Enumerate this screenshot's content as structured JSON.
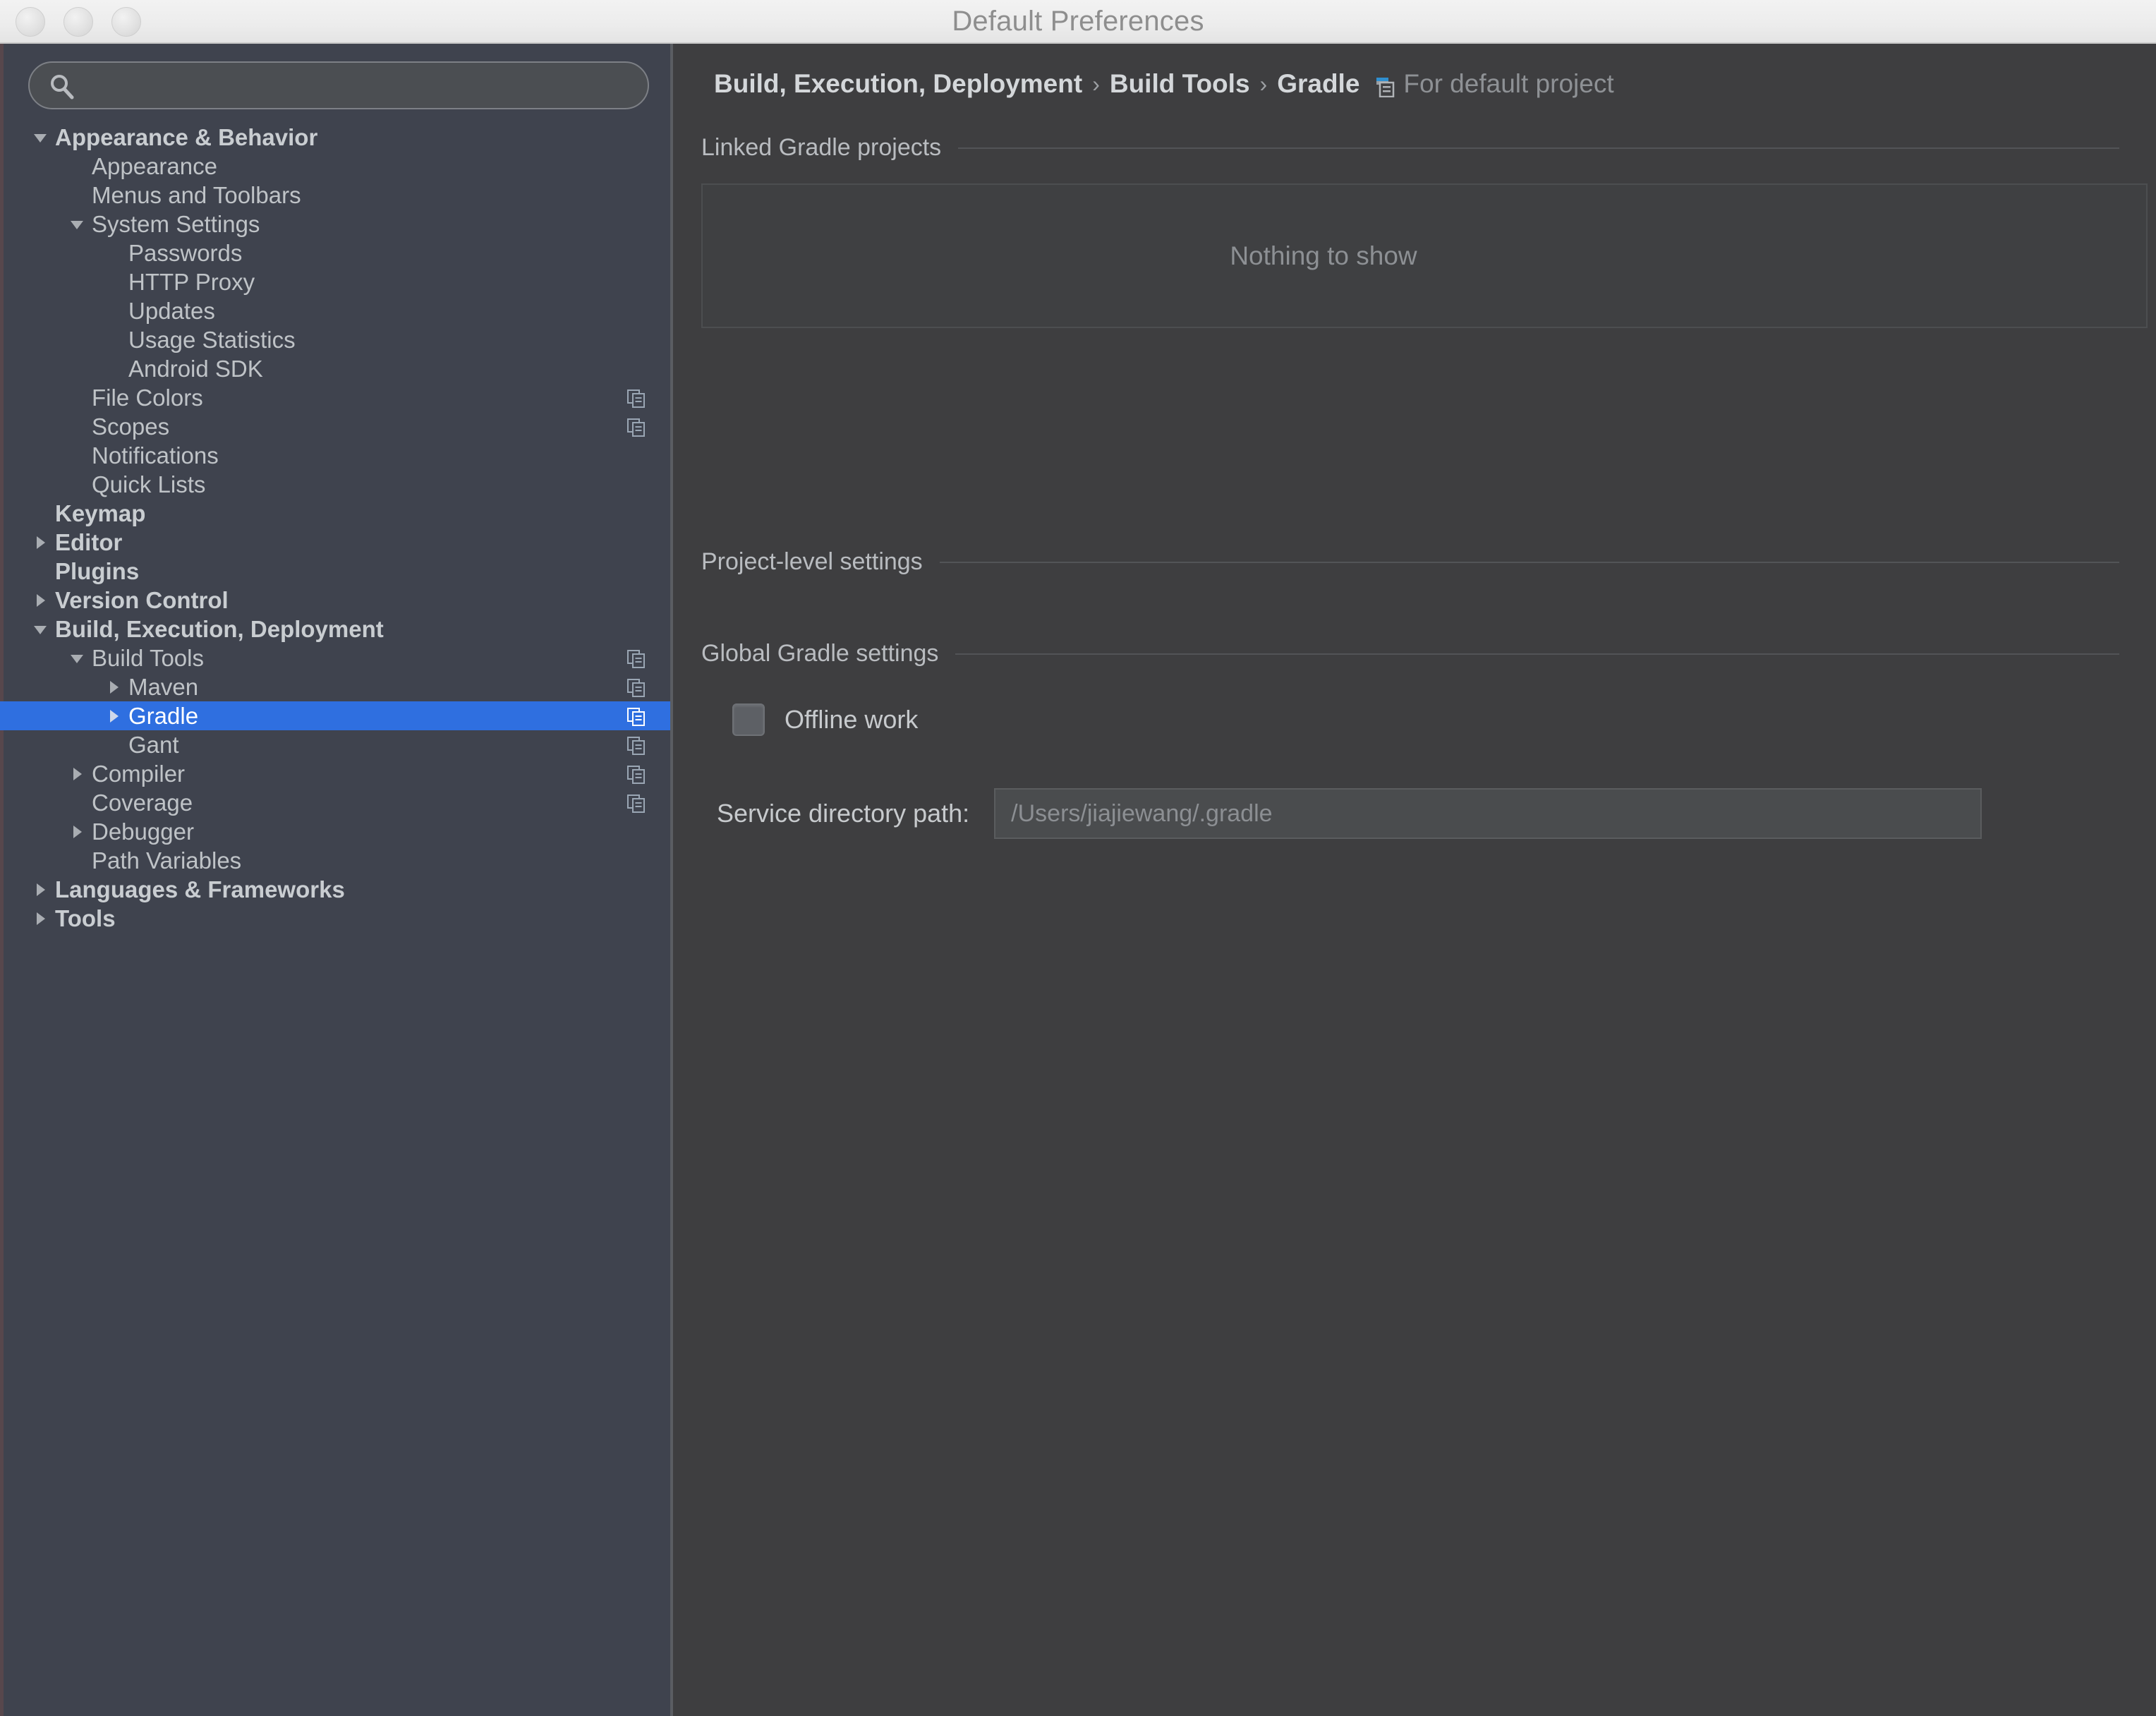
{
  "window": {
    "title": "Default Preferences",
    "traffic_lights": [
      "close",
      "minimize",
      "maximize"
    ]
  },
  "search": {
    "value": "",
    "placeholder": "",
    "icon": "search-icon"
  },
  "sidebar": {
    "copy_icon_name": "copy-icon",
    "items": [
      {
        "label": "Appearance & Behavior",
        "indent": 0,
        "arrow": "down",
        "bold": true,
        "copy": false,
        "selected": false
      },
      {
        "label": "Appearance",
        "indent": 1,
        "arrow": "none",
        "bold": false,
        "copy": false,
        "selected": false
      },
      {
        "label": "Menus and Toolbars",
        "indent": 1,
        "arrow": "none",
        "bold": false,
        "copy": false,
        "selected": false
      },
      {
        "label": "System Settings",
        "indent": 1,
        "arrow": "down",
        "bold": false,
        "copy": false,
        "selected": false
      },
      {
        "label": "Passwords",
        "indent": 2,
        "arrow": "none",
        "bold": false,
        "copy": false,
        "selected": false
      },
      {
        "label": "HTTP Proxy",
        "indent": 2,
        "arrow": "none",
        "bold": false,
        "copy": false,
        "selected": false
      },
      {
        "label": "Updates",
        "indent": 2,
        "arrow": "none",
        "bold": false,
        "copy": false,
        "selected": false
      },
      {
        "label": "Usage Statistics",
        "indent": 2,
        "arrow": "none",
        "bold": false,
        "copy": false,
        "selected": false
      },
      {
        "label": "Android SDK",
        "indent": 2,
        "arrow": "none",
        "bold": false,
        "copy": false,
        "selected": false
      },
      {
        "label": "File Colors",
        "indent": 1,
        "arrow": "none",
        "bold": false,
        "copy": true,
        "selected": false
      },
      {
        "label": "Scopes",
        "indent": 1,
        "arrow": "none",
        "bold": false,
        "copy": true,
        "selected": false
      },
      {
        "label": "Notifications",
        "indent": 1,
        "arrow": "none",
        "bold": false,
        "copy": false,
        "selected": false
      },
      {
        "label": "Quick Lists",
        "indent": 1,
        "arrow": "none",
        "bold": false,
        "copy": false,
        "selected": false
      },
      {
        "label": "Keymap",
        "indent": 0,
        "arrow": "none",
        "bold": true,
        "copy": false,
        "selected": false
      },
      {
        "label": "Editor",
        "indent": 0,
        "arrow": "right",
        "bold": true,
        "copy": false,
        "selected": false
      },
      {
        "label": "Plugins",
        "indent": 0,
        "arrow": "none",
        "bold": true,
        "copy": false,
        "selected": false
      },
      {
        "label": "Version Control",
        "indent": 0,
        "arrow": "right",
        "bold": true,
        "copy": false,
        "selected": false
      },
      {
        "label": "Build, Execution, Deployment",
        "indent": 0,
        "arrow": "down",
        "bold": true,
        "copy": false,
        "selected": false
      },
      {
        "label": "Build Tools",
        "indent": 1,
        "arrow": "down",
        "bold": false,
        "copy": true,
        "selected": false
      },
      {
        "label": "Maven",
        "indent": 2,
        "arrow": "right",
        "bold": false,
        "copy": true,
        "selected": false
      },
      {
        "label": "Gradle",
        "indent": 2,
        "arrow": "right",
        "bold": false,
        "copy": true,
        "selected": true
      },
      {
        "label": "Gant",
        "indent": 2,
        "arrow": "none",
        "bold": false,
        "copy": true,
        "selected": false
      },
      {
        "label": "Compiler",
        "indent": 1,
        "arrow": "right",
        "bold": false,
        "copy": true,
        "selected": false
      },
      {
        "label": "Coverage",
        "indent": 1,
        "arrow": "none",
        "bold": false,
        "copy": true,
        "selected": false
      },
      {
        "label": "Debugger",
        "indent": 1,
        "arrow": "right",
        "bold": false,
        "copy": false,
        "selected": false
      },
      {
        "label": "Path Variables",
        "indent": 1,
        "arrow": "none",
        "bold": false,
        "copy": false,
        "selected": false
      },
      {
        "label": "Languages & Frameworks",
        "indent": 0,
        "arrow": "right",
        "bold": true,
        "copy": false,
        "selected": false
      },
      {
        "label": "Tools",
        "indent": 0,
        "arrow": "right",
        "bold": true,
        "copy": false,
        "selected": false
      }
    ]
  },
  "breadcrumb": {
    "crumbs": [
      "Build, Execution, Deployment",
      "Build Tools",
      "Gradle"
    ],
    "separator": "›",
    "project_icon": "project-icon",
    "project_scope": "For default project"
  },
  "main": {
    "sections": {
      "linked_projects": "Linked Gradle projects",
      "project_level": "Project-level settings",
      "global_settings": "Global Gradle settings"
    },
    "linked_projects_empty": "Nothing to show",
    "offline_work": {
      "label": "Offline work",
      "checked": false
    },
    "service_directory": {
      "label": "Service directory path:",
      "value": "/Users/jiajiewang/.gradle"
    }
  },
  "colors": {
    "selection_blue": "#2f6fe0",
    "sidebar_bg": "#3f434e",
    "panel_bg": "#3e3e40",
    "titlebar_bg": "#ececec"
  }
}
